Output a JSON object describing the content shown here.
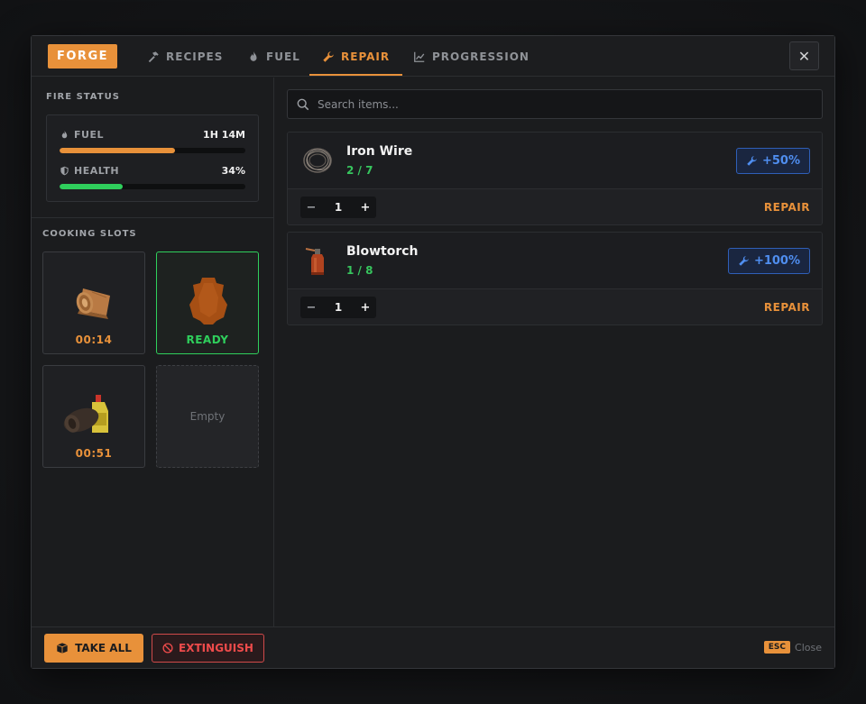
{
  "header": {
    "title_badge": "FORGE",
    "tabs": [
      {
        "label": "RECIPES",
        "icon": "hammer-icon"
      },
      {
        "label": "FUEL",
        "icon": "flame-icon"
      },
      {
        "label": "REPAIR",
        "icon": "wrench-icon",
        "active": true
      },
      {
        "label": "PROGRESSION",
        "icon": "chart-line-icon"
      }
    ],
    "close_icon": "close-icon"
  },
  "fire_status": {
    "title": "FIRE STATUS",
    "fuel": {
      "label": "FUEL",
      "value": "1H 14M",
      "fill_fraction": 0.62
    },
    "health": {
      "label": "HEALTH",
      "value": "34%",
      "fill_fraction": 0.34
    }
  },
  "cooking": {
    "title": "COOKING SLOTS",
    "slots": [
      {
        "item": "leather-roll",
        "label": "00:14",
        "state": "cooking"
      },
      {
        "item": "leather-hide",
        "label": "READY",
        "state": "ready"
      },
      {
        "item": "cloth-and-bottle",
        "label": "00:51",
        "state": "cooking"
      },
      {
        "label": "Empty",
        "state": "empty"
      }
    ]
  },
  "search": {
    "placeholder": "Search items..."
  },
  "repair_items": [
    {
      "name": "Iron Wire",
      "count": "2 / 7",
      "bonus": "+50%",
      "quantity": "1",
      "action": "REPAIR"
    },
    {
      "name": "Blowtorch",
      "count": "1 / 8",
      "bonus": "+100%",
      "quantity": "1",
      "action": "REPAIR"
    }
  ],
  "footer": {
    "take_all": "TAKE ALL",
    "extinguish": "EXTINGUISH",
    "esc_key": "ESC",
    "esc_label": "Close"
  },
  "colors": {
    "accent": "#e8913a",
    "fuel_bar": "#e8913a",
    "health_bar": "#2fcf5c",
    "ready": "#2fcf5c",
    "repair_blue": "#4f8ef0",
    "danger": "#ee4b4b"
  }
}
